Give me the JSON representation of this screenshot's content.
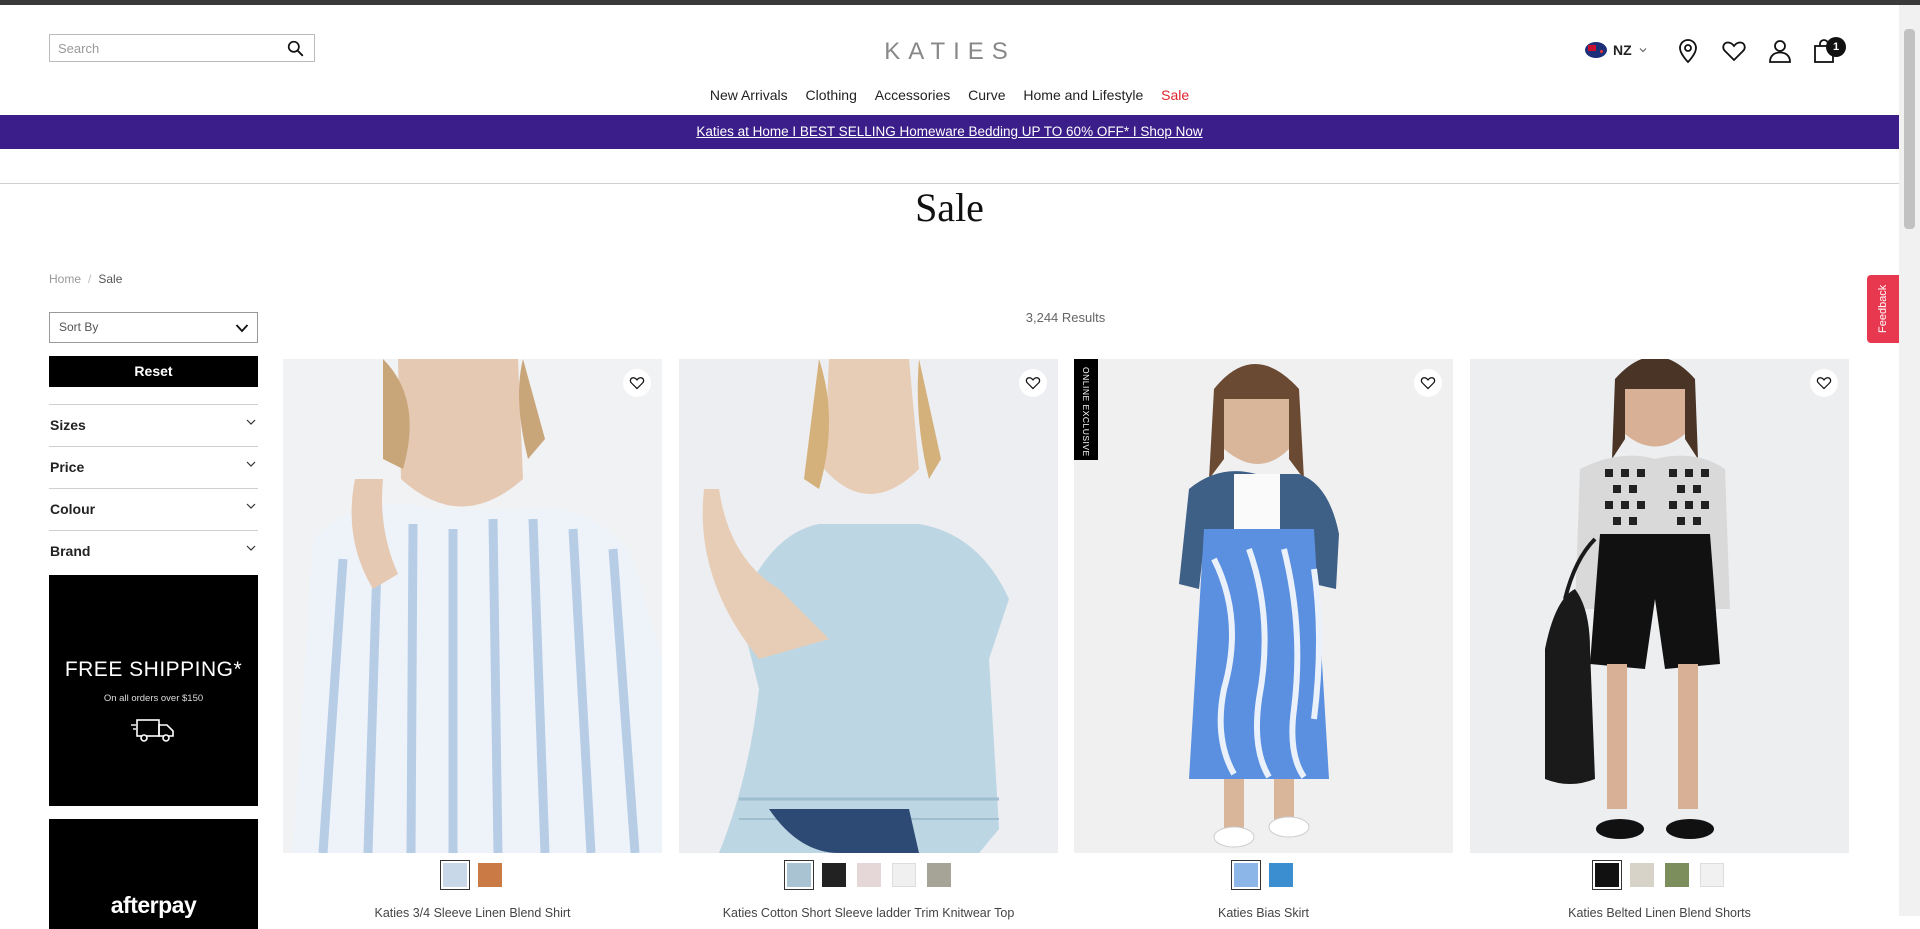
{
  "header": {
    "search_placeholder": "Search",
    "logo": "KATIES",
    "locale": "NZ",
    "bag_count": "1"
  },
  "nav": {
    "items": [
      "New Arrivals",
      "Clothing",
      "Accessories",
      "Curve",
      "Home and Lifestyle",
      "Sale"
    ]
  },
  "promo": {
    "text": "Katies at Home I BEST SELLING Homeware Bedding UP TO 60% OFF* I Shop Now",
    "color": "#3b1e8a"
  },
  "page": {
    "title": "Sale",
    "breadcrumb": [
      "Home",
      "Sale"
    ],
    "results": "3,244 Results"
  },
  "sidebar": {
    "sort_label": "Sort By",
    "reset_label": "Reset",
    "filters": [
      "Sizes",
      "Price",
      "Colour",
      "Brand"
    ],
    "shipping_title": "FREE SHIPPING*",
    "shipping_sub": "On all orders over $150",
    "afterpay": "afterpay"
  },
  "feedback": "Feedback",
  "products": [
    {
      "name": "Katies 3/4 Sleeve Linen Blend Shirt",
      "badge": "",
      "swatches": [
        "#c9d8e8",
        "#c97a45"
      ]
    },
    {
      "name": "Katies Cotton Short Sleeve ladder Trim Knitwear Top",
      "badge": "",
      "swatches": [
        "#a9c3d3",
        "#222222",
        "#e5d6d8",
        "#f0f0f0",
        "#a6a496"
      ]
    },
    {
      "name": "Katies Bias Skirt",
      "badge": "ONLINE EXCLUSIVE",
      "swatches": [
        "#8db6e8",
        "#3b8fd0"
      ]
    },
    {
      "name": "Katies Belted Linen Blend Shorts",
      "badge": "",
      "swatches": [
        "#111111",
        "#d8d3c9",
        "#7b8e5c",
        "#f1f1f1"
      ]
    }
  ]
}
